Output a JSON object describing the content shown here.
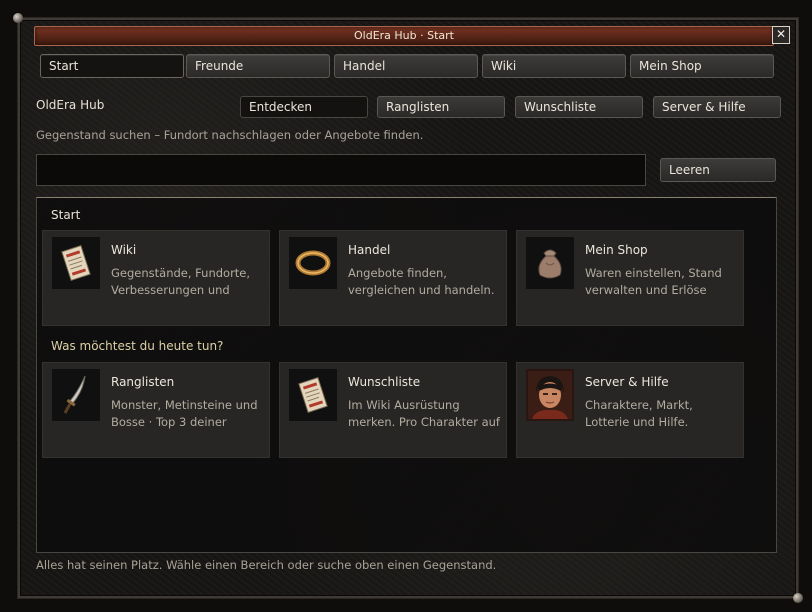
{
  "window": {
    "title": "OldEra Hub · Start",
    "close_label": "✕"
  },
  "tabs": [
    {
      "label": "Start"
    },
    {
      "label": "Freunde"
    },
    {
      "label": "Handel"
    },
    {
      "label": "Wiki"
    },
    {
      "label": "Mein Shop"
    }
  ],
  "hub_label": "OldEra Hub",
  "subtabs": [
    {
      "label": "Entdecken"
    },
    {
      "label": "Ranglisten"
    },
    {
      "label": "Wunschliste"
    },
    {
      "label": "Server & Hilfe"
    }
  ],
  "search": {
    "description": "Gegenstand suchen – Fundort nachschlagen oder Angebote finden.",
    "value": "",
    "clear_label": "Leeren"
  },
  "sections": {
    "start_title": "Start",
    "todo_title": "Was möchtest du heute tun?"
  },
  "cards_start": [
    {
      "title": "Wiki",
      "desc": "Gegenstände, Fundorte, Verbesserungen und",
      "icon": "scroll-book-icon"
    },
    {
      "title": "Handel",
      "desc": "Angebote finden, vergleichen und handeln.",
      "icon": "gold-ring-icon"
    },
    {
      "title": "Mein Shop",
      "desc": "Waren einstellen, Stand verwalten und Erlöse",
      "icon": "money-bag-icon"
    }
  ],
  "cards_todo": [
    {
      "title": "Ranglisten",
      "desc": "Monster, Metinsteine und Bosse · Top 3 deiner",
      "icon": "sword-icon"
    },
    {
      "title": "Wunschliste",
      "desc": "Im Wiki Ausrüstung merken. Pro Charakter auf",
      "icon": "scroll-book-icon"
    },
    {
      "title": "Server & Hilfe",
      "desc": "Charaktere, Markt, Lotterie und Hilfe.",
      "icon": "character-portrait-icon"
    }
  ],
  "status_text": "Alles hat seinen Platz. Wähle einen Bereich oder suche oben einen Gegenstand.",
  "colors": {
    "title_bar": "#5a2618",
    "accent_text": "#ddd1a8",
    "panel_bg": "#0e0d0c"
  }
}
